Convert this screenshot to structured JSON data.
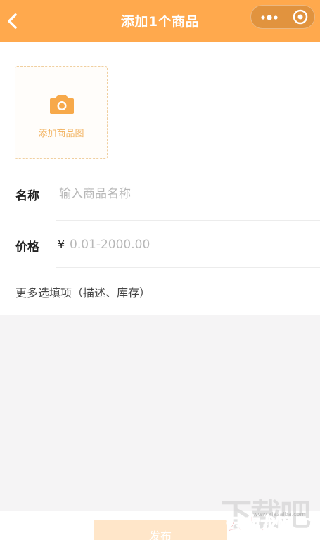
{
  "header": {
    "title": "添加1个商品",
    "back_icon": "chevron-left-icon",
    "more_icon": "more-dots-icon",
    "close_icon": "target-circle-icon",
    "bg_color": "#ffa94d"
  },
  "upload": {
    "label": "添加商品图",
    "icon": "camera-icon",
    "accent_color": "#f2b25e"
  },
  "form": {
    "name_label": "名称",
    "name_placeholder": "输入商品名称",
    "price_label": "价格",
    "currency_symbol": "¥",
    "price_placeholder": "0.01-2000.00",
    "more_options": "更多选填项（描述、库存）"
  },
  "footer": {
    "publish_label": "发布"
  },
  "watermark": {
    "text_main": "下载吧",
    "text_site": "www.xiazaiba.com",
    "text_cn": "云南龙网"
  }
}
